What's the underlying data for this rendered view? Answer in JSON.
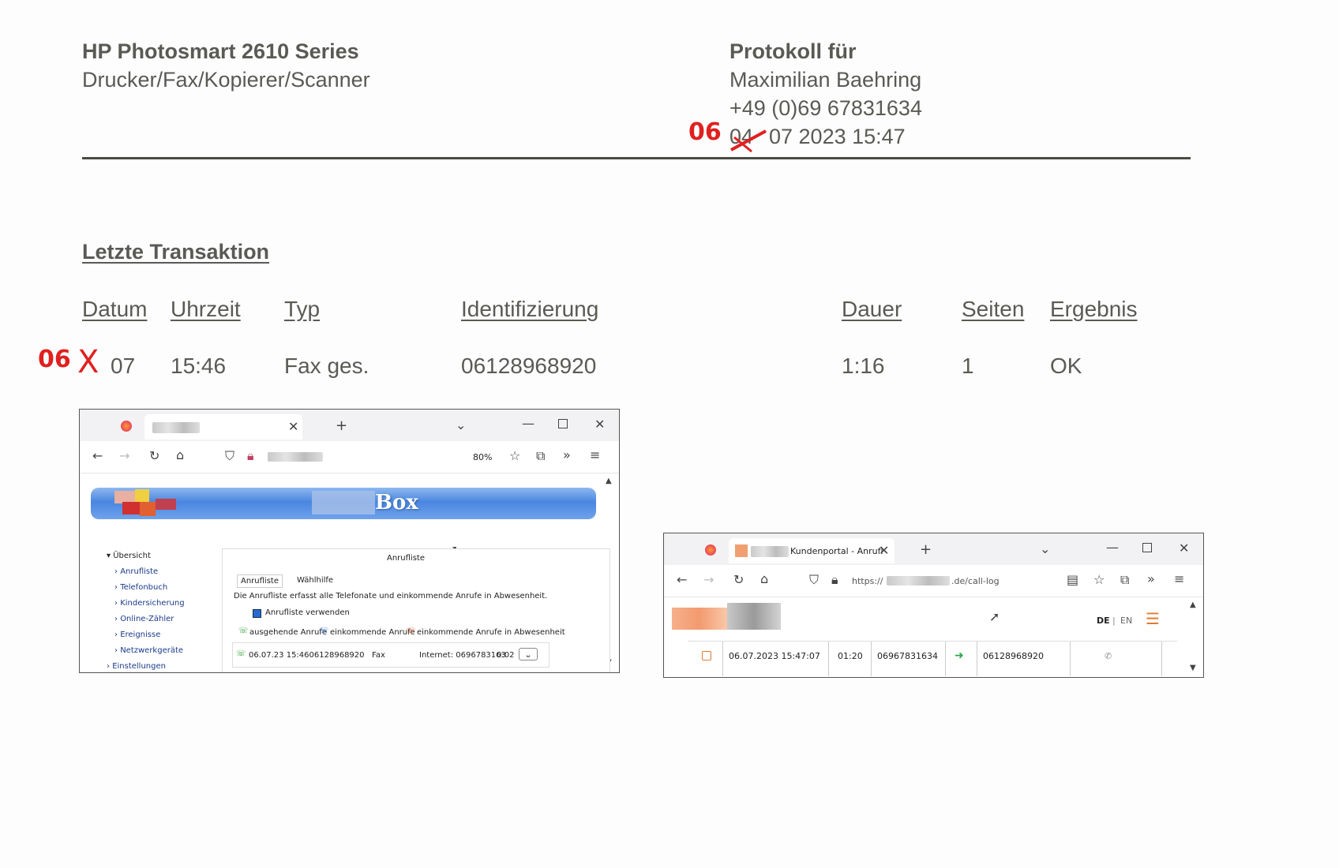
{
  "header": {
    "device_title": "HP Photosmart 2610 Series",
    "device_subtitle": "Drucker/Fax/Kopierer/Scanner",
    "protocol_label": "Protokoll für",
    "owner_name": "Maximilian Baehring",
    "owner_phone": "+49 (0)69 67831634",
    "date_old_day": "04",
    "date_correction": "06",
    "date_rest": "07 2023 15:47"
  },
  "section": {
    "title": "Letzte Transaktion"
  },
  "table": {
    "columns": [
      "Datum",
      "Uhrzeit",
      "Typ",
      "Identifizierung",
      "Dauer",
      "Seiten",
      "Ergebnis"
    ],
    "row": {
      "date_correction": "06",
      "date_old_day": "X",
      "date_month": "07",
      "time": "15:46",
      "type": "Fax ges.",
      "identification": "06128968920",
      "duration": "1:16",
      "pages": "1",
      "result": "OK"
    }
  },
  "screenshot_left": {
    "zoom": "80%",
    "banner_text": "Box",
    "tree": [
      "Übersicht",
      "Anrufliste",
      "Telefonbuch",
      "Kindersicherung",
      "Online-Zähler",
      "Ereignisse",
      "Netzwerkgeräte",
      "Einstellungen"
    ],
    "panel_title": "Anrufliste",
    "tabs": [
      "Anrufliste",
      "Wählhilfe"
    ],
    "description": "Die Anrufliste erfasst alle Telefonate und einkommende Anrufe in Abwesenheit.",
    "checkbox_label": "Anrufliste verwenden",
    "legend": [
      "ausgehende Anrufe",
      "einkommende Anrufe",
      "einkommende Anrufe in Abwesenheit"
    ],
    "entry": {
      "datetime_number": "06.07.23 15:4606128968920",
      "type": "Fax",
      "line": "Internet: 0696783163",
      "duration": "0:02"
    }
  },
  "screenshot_right": {
    "tab_title": "Kundenportal - Anrufl",
    "url_prefix": "https://",
    "url_suffix": ".de/call-log",
    "lang_de": "DE",
    "lang_sep": "|",
    "lang_en": "EN",
    "row": {
      "datetime": "06.07.2023 15:47:07",
      "duration": "01:20",
      "from": "06967831634",
      "to": "06128968920"
    }
  }
}
